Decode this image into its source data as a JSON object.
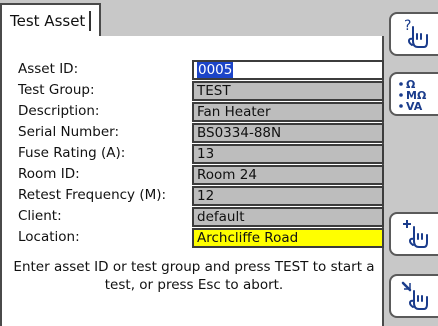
{
  "tab": {
    "title": "Test Asset"
  },
  "form": {
    "fields": [
      {
        "label": "Asset ID:",
        "value": "0005"
      },
      {
        "label": "Test Group:",
        "value": "TEST"
      },
      {
        "label": "Description:",
        "value": "Fan Heater"
      },
      {
        "label": "Serial Number:",
        "value": "BS0334-88N"
      },
      {
        "label": "Fuse Rating (A):",
        "value": "13"
      },
      {
        "label": "Room ID:",
        "value": "Room 24"
      },
      {
        "label": "Retest Frequency (M):",
        "value": "12"
      },
      {
        "label": "Client:",
        "value": "default"
      },
      {
        "label": "Location:",
        "value": "Archcliffe Road"
      }
    ],
    "active_field": "Asset ID:",
    "highlight_color": "#ffff00",
    "selection_color": "#1c44c8"
  },
  "hint": {
    "line1": "Enter asset ID or test group and press TEST to start a",
    "line2": "test, or press Esc to abort."
  },
  "softkeys": {
    "help_icon": "help-hand-icon",
    "measure_icon": "measure-units-icon",
    "measure_units": [
      "Ω",
      "MΩ",
      "VA"
    ],
    "add_icon": "add-hand-icon",
    "edit_icon": "edit-hand-icon"
  }
}
